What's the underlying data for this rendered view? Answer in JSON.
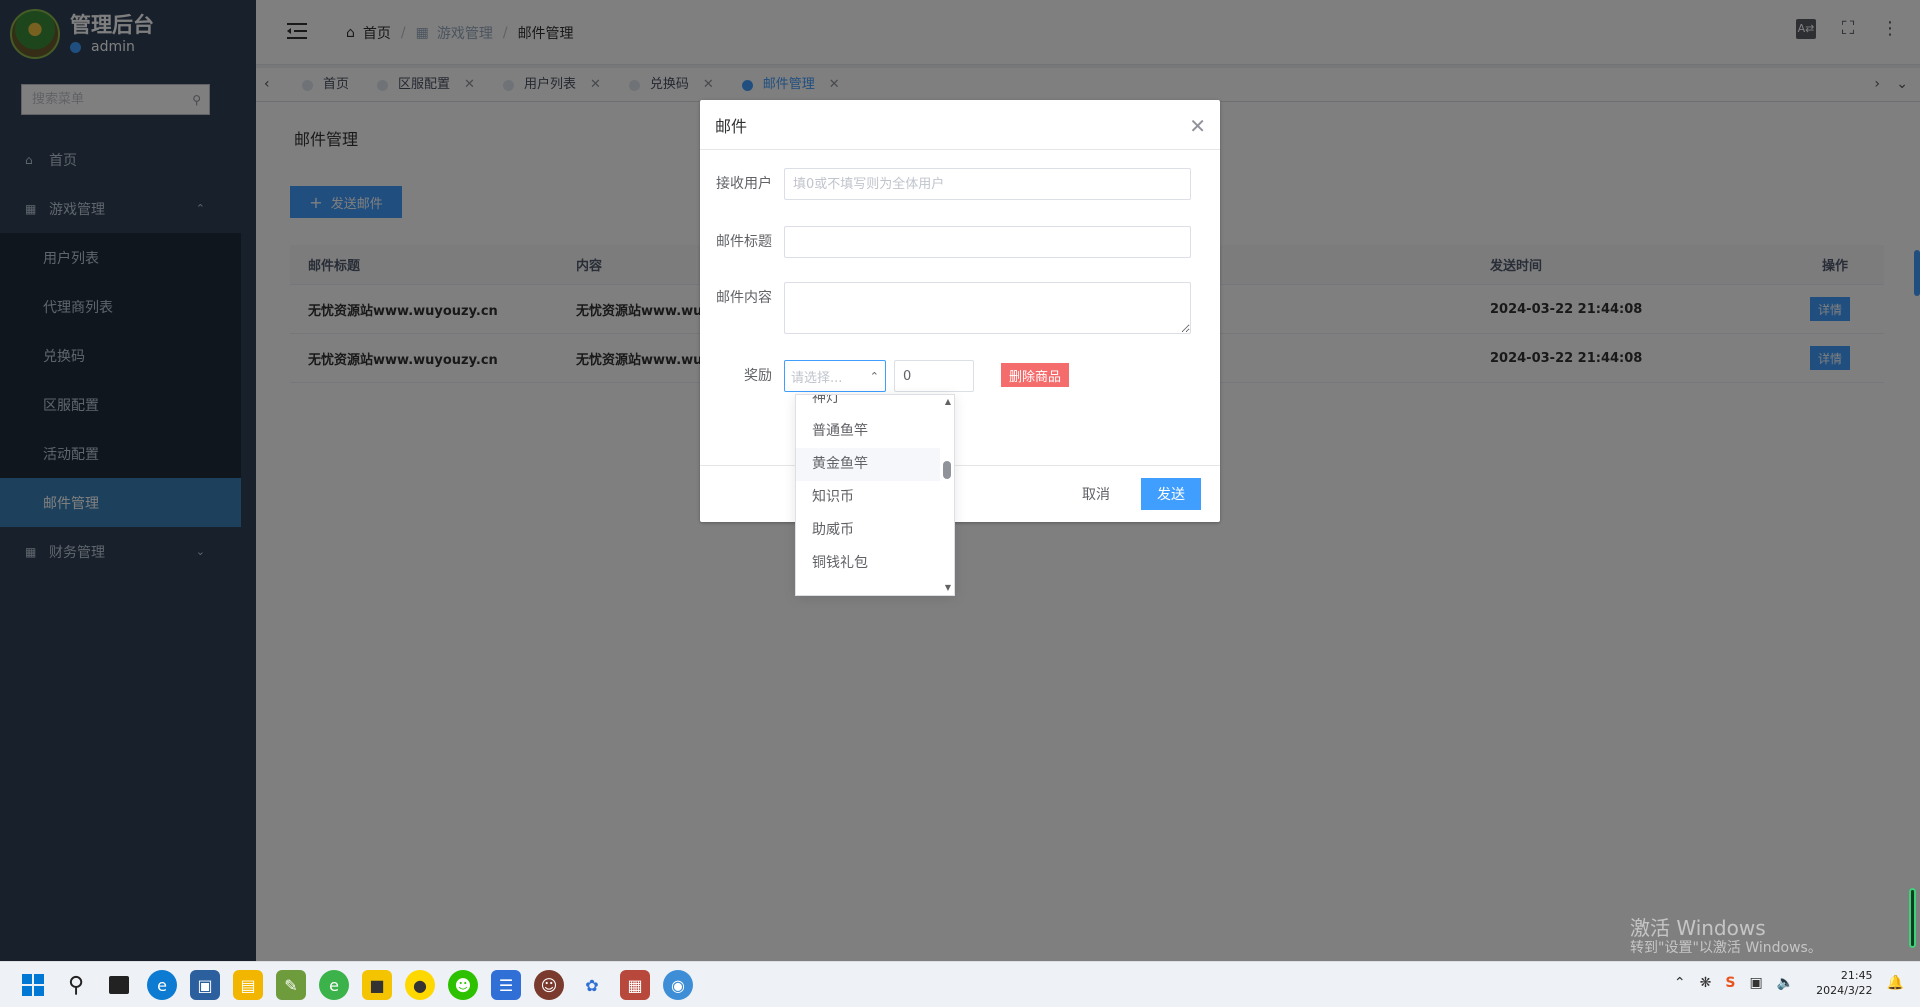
{
  "sidebar": {
    "app_title": "管理后台",
    "username": "admin",
    "search_placeholder": "搜索菜单",
    "menu": [
      {
        "label": "首页"
      },
      {
        "label": "游戏管理"
      },
      {
        "label": "用户列表"
      },
      {
        "label": "代理商列表"
      },
      {
        "label": "兑换码"
      },
      {
        "label": "区服配置"
      },
      {
        "label": "活动配置"
      },
      {
        "label": "邮件管理"
      },
      {
        "label": "财务管理"
      }
    ]
  },
  "header": {
    "breadcrumb": [
      "首页",
      "游戏管理",
      "邮件管理"
    ],
    "icons": [
      "translate-icon",
      "fullscreen-icon",
      "more-icon"
    ]
  },
  "tags": [
    {
      "label": "首页"
    },
    {
      "label": "区服配置"
    },
    {
      "label": "用户列表"
    },
    {
      "label": "兑换码"
    },
    {
      "label": "邮件管理"
    }
  ],
  "main": {
    "page_title": "邮件管理",
    "send_button": "发送邮件",
    "table": {
      "headers": [
        "邮件标题",
        "内容",
        "发送时间",
        "操作"
      ],
      "rows": [
        {
          "title": "无忧资源站www.wuyouzy.cn",
          "content": "无忧资源站www.wu",
          "time": "2024-03-22 21:44:08",
          "action": "详情"
        },
        {
          "title": "无忧资源站www.wuyouzy.cn",
          "content": "无忧资源站www.wu",
          "time": "2024-03-22 21:44:08",
          "action": "详情"
        }
      ]
    }
  },
  "dialog": {
    "title": "邮件",
    "fields": {
      "recipient_label": "接收用户",
      "recipient_placeholder": "填0或不填写则为全体用户",
      "subject_label": "邮件标题",
      "content_label": "邮件内容",
      "reward_label": "奖励",
      "reward_select_placeholder": "请选择...",
      "reward_qty": "0",
      "delete_button": "删除商品"
    },
    "cancel": "取消",
    "ok": "发送"
  },
  "dropdown": {
    "options": [
      "神灯",
      "普通鱼竿",
      "黄金鱼竿",
      "知识币",
      "助威币",
      "铜钱礼包"
    ],
    "hovered": "黄金鱼竿"
  },
  "watermark": {
    "line1": "激活 Windows",
    "line2": "转到\"设置\"以激活 Windows。"
  },
  "taskbar": {
    "time": "21:45",
    "date": "2024/3/22"
  }
}
